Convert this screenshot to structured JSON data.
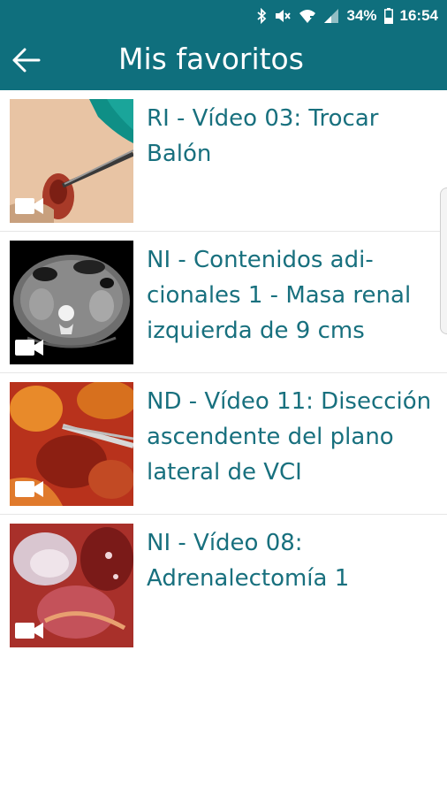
{
  "status_bar": {
    "battery_percent": "34%",
    "time": "16:54",
    "icons": [
      "bluetooth-icon",
      "mute-icon",
      "wifi-icon",
      "signal-icon",
      "battery-icon"
    ]
  },
  "app_bar": {
    "title": "Mis favoritos",
    "back_icon": "arrow-left-icon"
  },
  "favorites": [
    {
      "title": "RI - Vídeo 03: Trocar Balón",
      "thumbnail": "surgery-trocar",
      "media_icon": "video-camera-icon"
    },
    {
      "title": "NI - Contenidos adi-cionales 1 - Masa renal izquierda de 9 cms",
      "thumbnail": "ct-scan",
      "media_icon": "video-camera-icon"
    },
    {
      "title": "ND - Vídeo 11: Disección ascendente del plano lateral de VCI",
      "thumbnail": "laparoscopy-dissection",
      "media_icon": "video-camera-icon"
    },
    {
      "title": "NI - Vídeo 08: Adrenalectomía 1",
      "thumbnail": "laparoscopy-adrenal",
      "media_icon": "video-camera-icon"
    }
  ],
  "colors": {
    "primary": "#0f6f7d",
    "item_text": "#18707e",
    "divider": "#e6e6e6"
  }
}
